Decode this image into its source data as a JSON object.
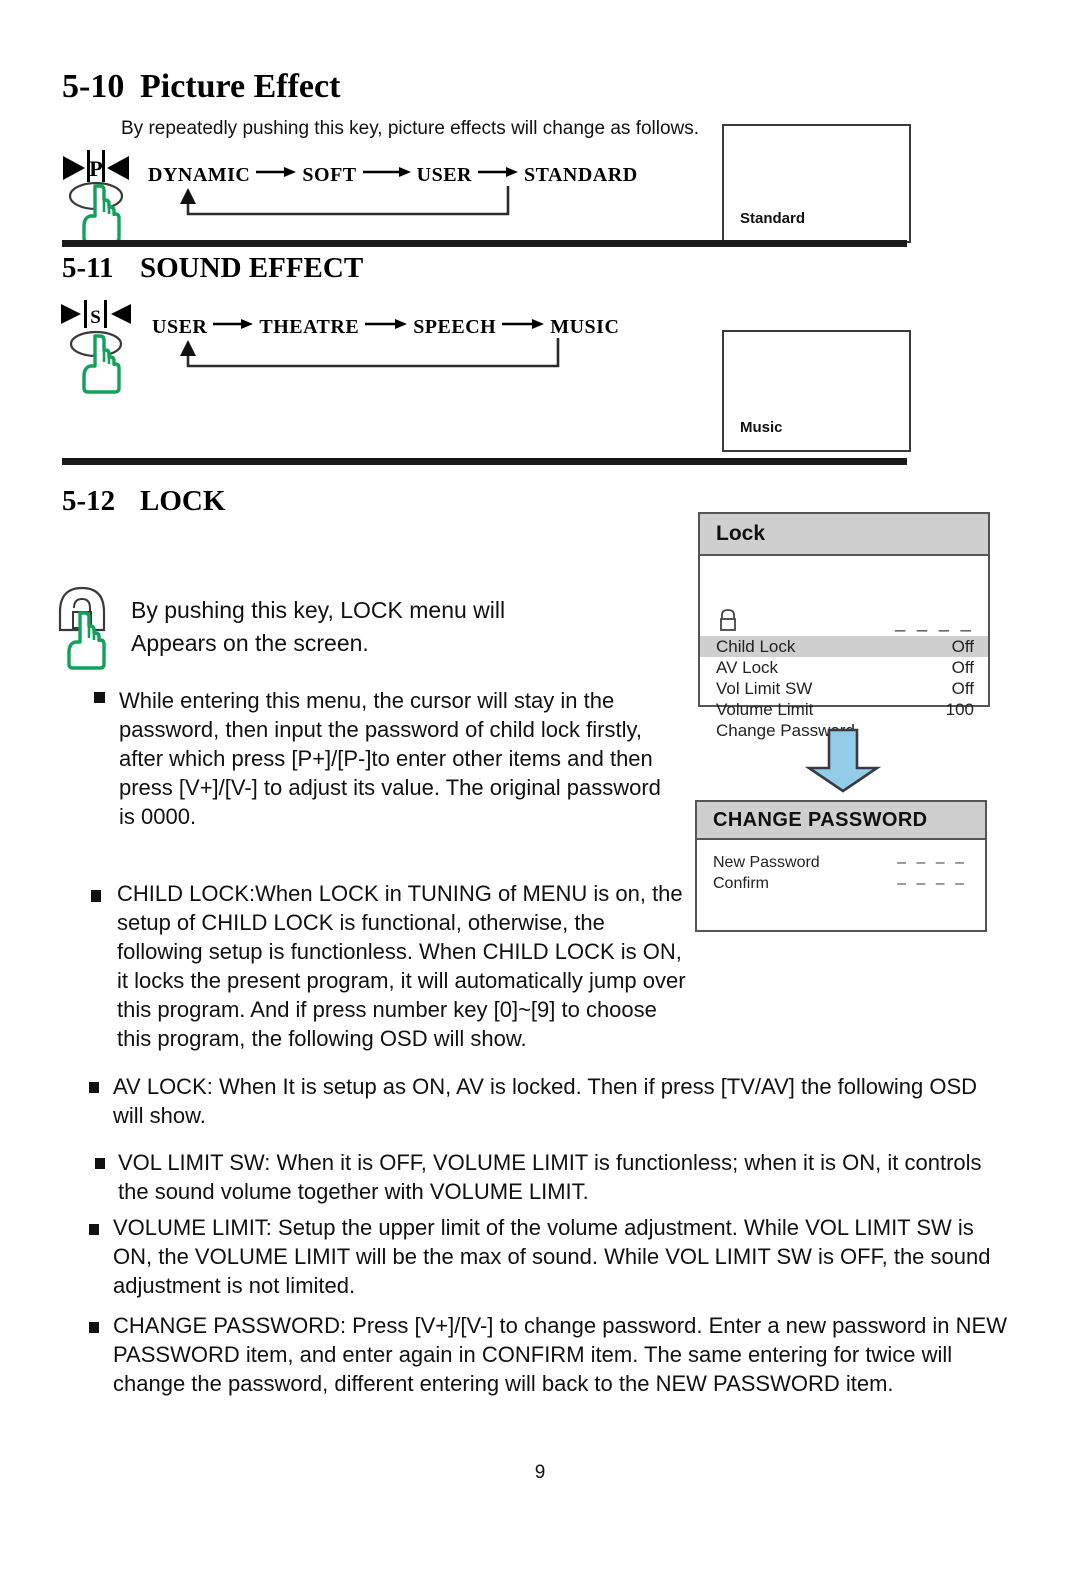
{
  "section_510": {
    "number": "5-10",
    "title": "Picture Effect",
    "intro": "By repeatedly pushing this key, picture effects will change as follows.",
    "key_label": "P",
    "flow": [
      "DYNAMIC",
      "SOFT",
      "USER",
      "STANDARD"
    ],
    "preview_label": "Standard"
  },
  "section_511": {
    "number": "5-11",
    "title": "SOUND EFFECT",
    "key_label": "S",
    "flow": [
      "USER",
      "THEATRE",
      "SPEECH",
      "MUSIC"
    ],
    "preview_label": "Music"
  },
  "section_512": {
    "number": "5-12",
    "title": "LOCK",
    "intro_line1": "By pushing this key, LOCK menu will",
    "intro_line2": "Appears on the screen.",
    "bullets": [
      "While entering this menu, the cursor will stay in the password, then input the password of child lock firstly, after which press [P+]/[P-]to enter other items and then press [V+]/[V-] to adjust its value. The original password is 0000.",
      "CHILD LOCK:When LOCK in TUNING of MENU is on, the setup of CHILD LOCK is functional, otherwise, the following setup is functionless. When CHILD LOCK is ON, it locks the present program, it will  automatically jump over this program. And if press number key [0]~[9] to choose this program, the following OSD will show.",
      "AV LOCK: When It is setup as ON, AV is locked. Then if press [TV/AV] the following OSD will show.",
      "VOL LIMIT SW: When it is OFF, VOLUME LIMIT is functionless; when it is ON, it controls the sound volume together with VOLUME LIMIT.",
      "VOLUME LIMIT: Setup the upper limit of the volume adjustment. While VOL LIMIT SW is ON, the VOLUME LIMIT will be the max of sound. While VOL LIMIT SW is OFF, the sound adjustment is not limited.",
      "CHANGE PASSWORD: Press [V+]/[V-] to change password. Enter a new password in NEW PASSWORD item, and enter again in CONFIRM item. The same entering for twice will change the password, different entering will back to the NEW PASSWORD item."
    ]
  },
  "lock_osd": {
    "title": "Lock",
    "password_value": "– – – –",
    "rows": [
      {
        "label": "Child Lock",
        "value": "Off",
        "selected": true
      },
      {
        "label": "AV Lock",
        "value": "Off",
        "selected": false
      },
      {
        "label": "Vol Limit SW",
        "value": "Off",
        "selected": false
      },
      {
        "label": "Volume Limit",
        "value": "100",
        "selected": false
      },
      {
        "label": "Change Password",
        "value": "",
        "selected": false
      }
    ]
  },
  "change_password_osd": {
    "title": "CHANGE PASSWORD",
    "rows": [
      {
        "label": "New Password",
        "value": "– – – –"
      },
      {
        "label": "Confirm",
        "value": "– – – –"
      }
    ]
  },
  "footer": {
    "page_number": "9"
  },
  "colors": {
    "hand_green": "#11a15a",
    "arrow_blue": "#92cce8",
    "osd_header_gray": "#cfcfcf",
    "rule_black": "#1a1a1a"
  }
}
